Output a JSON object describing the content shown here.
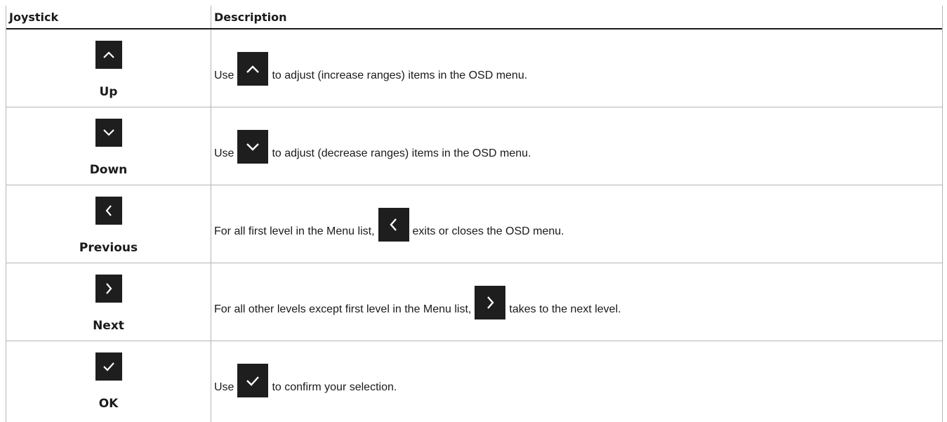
{
  "table": {
    "headers": {
      "joystick": "Joystick",
      "description": "Description"
    },
    "rows": [
      {
        "label": "Up",
        "icon": "chevron-up-icon",
        "before": "Use",
        "after": "to adjust (increase ranges) items in the OSD menu."
      },
      {
        "label": "Down",
        "icon": "chevron-down-icon",
        "before": "Use",
        "after": "to adjust (decrease ranges) items in the OSD menu."
      },
      {
        "label": "Previous",
        "icon": "chevron-left-icon",
        "before": "For all first level in the Menu list,",
        "after": "exits or closes the OSD menu."
      },
      {
        "label": "Next",
        "icon": "chevron-right-icon",
        "before": "For all other levels except first level in the Menu list,",
        "after": "takes to the next level."
      },
      {
        "label": "OK",
        "icon": "checkmark-icon",
        "before": "Use",
        "after": "to confirm your selection."
      }
    ]
  },
  "colors": {
    "button_background": "#1e1e1e",
    "icon": "#ffffff",
    "text": "#1a1a1a",
    "grid": "#b5b5b5"
  }
}
